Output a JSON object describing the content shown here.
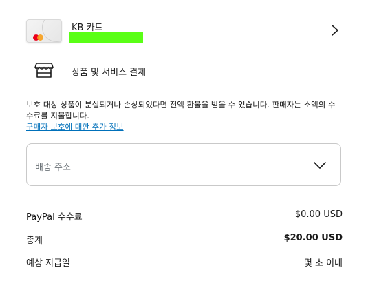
{
  "payment_method": {
    "card_name": "KB 카드",
    "icon": "mastercard-card-icon"
  },
  "goods_services": {
    "label": "상품 및 서비스 결제",
    "icon": "store-icon"
  },
  "protection": {
    "text": "보호 대상 상품이 분실되거나 손상되었다면 전액 환불을 받을 수 있습니다. 판매자는 소액의 수수료를 지불합니다.",
    "link": "구매자 보호에 대한 추가 정보"
  },
  "shipping": {
    "placeholder": "배송 주소"
  },
  "summary": {
    "fee_label": "PayPal 수수료",
    "fee_value": "$0.00 USD",
    "total_label": "총계",
    "total_value": "$20.00 USD",
    "eta_label": "예상 지급일",
    "eta_value": "몇 초 이내"
  },
  "colors": {
    "link": "#0070ba",
    "redaction": "#5aff16"
  }
}
